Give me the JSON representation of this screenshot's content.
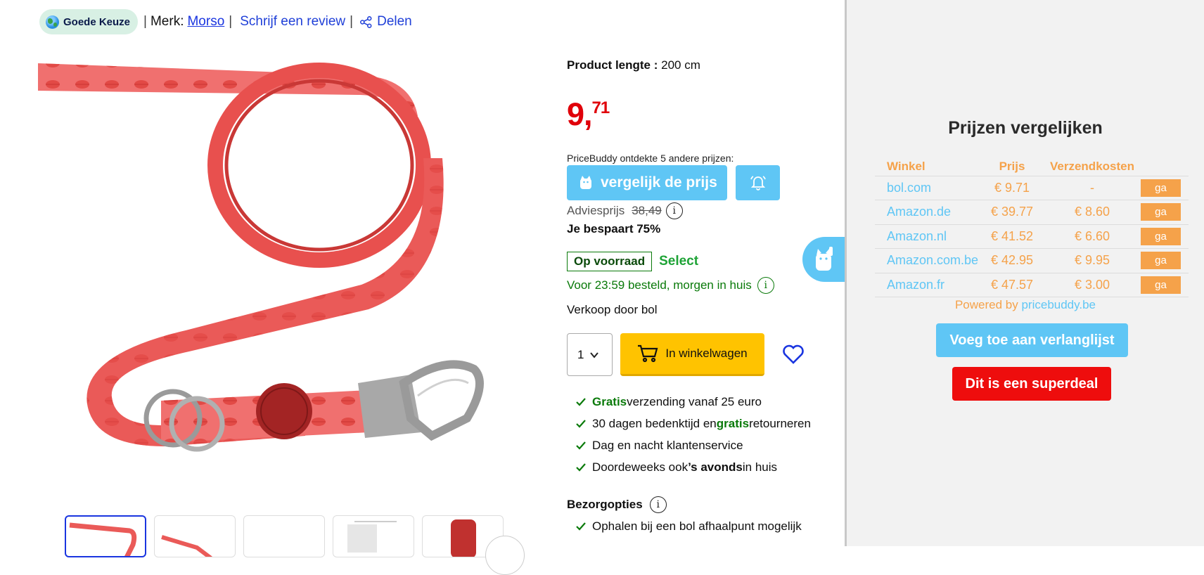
{
  "header": {
    "badge_label": "Goede Keuze",
    "brand_prefix": "Merk:",
    "brand_name": "Morso",
    "review_link": "Schrijf een review",
    "share_label": "Delen",
    "separator": "|"
  },
  "product": {
    "spec_label": "Product lengte :",
    "spec_value": "200 cm",
    "price_whole": "9,",
    "price_cents": "71",
    "pricebuddy_text": "PriceBuddy ontdekte 5 andere prijzen:",
    "compare_button": "vergelijk de prijs",
    "advice_label": "Adviesprijs",
    "advice_price": "38,49",
    "saving": "Je bespaart 75%",
    "stock_label": "Op voorraad",
    "select_label": "Select",
    "delivery_text": "Voor 23:59 besteld, morgen in huis",
    "seller": "Verkoop door bol",
    "quantity": "1",
    "cart_button": "In winkelwagen",
    "usps": [
      {
        "pre": "",
        "bold": "Gratis",
        "post": " verzending vanaf 25 euro"
      },
      {
        "pre": "30 dagen bedenktijd en ",
        "bold": "gratis",
        "post": " retourneren"
      },
      {
        "pre": "Dag en nacht klantenservice",
        "bold": "",
        "post": ""
      },
      {
        "pre": "Doordeweeks ook ",
        "bold": "’s avonds",
        "post": " in huis"
      }
    ],
    "delivery_options_title": "Bezorgopties",
    "pickup_text": "Ophalen bij een bol afhaalpunt mogelijk"
  },
  "panel": {
    "title": "Prijzen vergelijken",
    "columns": [
      "Winkel",
      "Prijs",
      "Verzendkosten"
    ],
    "rows": [
      {
        "store": "bol.com",
        "price": "€ 9.71",
        "shipping": "-",
        "go": "ga"
      },
      {
        "store": "Amazon.de",
        "price": "€ 39.77",
        "shipping": "€ 8.60",
        "go": "ga"
      },
      {
        "store": "Amazon.nl",
        "price": "€ 41.52",
        "shipping": "€ 6.60",
        "go": "ga"
      },
      {
        "store": "Amazon.com.be",
        "price": "€ 42.95",
        "shipping": "€ 9.95",
        "go": "ga"
      },
      {
        "store": "Amazon.fr",
        "price": "€ 47.57",
        "shipping": "€ 3.00",
        "go": "ga"
      }
    ],
    "powered_prefix": "Powered by ",
    "powered_link": "pricebuddy.be",
    "wishlist_button": "Voeg toe aan verlanglijst",
    "deal_button": "Dit is een superdeal"
  },
  "colors": {
    "price_red": "#e0000a",
    "pricebuddy_blue": "#5fc6f5",
    "pricebuddy_orange": "#f5a24a",
    "cart_yellow": "#ffc300",
    "stock_green": "#0a7a0a",
    "deal_red": "#ee0d0d"
  },
  "icons": [
    "globe-icon",
    "share-icon",
    "cat-icon",
    "bell-icon",
    "info-icon",
    "chevron-down-icon",
    "cart-icon",
    "heart-icon",
    "check-icon"
  ]
}
